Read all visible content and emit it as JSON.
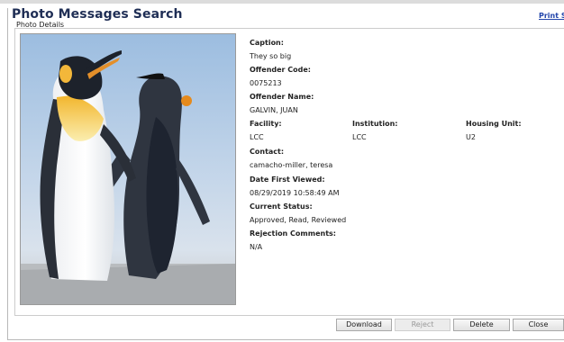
{
  "header": {
    "title": "Photo Messages Search",
    "print_label": "Print Scree"
  },
  "section": {
    "title": "Photo Details"
  },
  "photo": {
    "alt": "Two emperor penguins"
  },
  "fields": {
    "caption_label": "Caption:",
    "caption_value": "They so big",
    "offender_code_label": "Offender Code:",
    "offender_code_value": "0075213",
    "offender_name_label": "Offender Name:",
    "offender_name_value": "GALVIN, JUAN",
    "facility_label": "Facility:",
    "facility_value": "LCC",
    "institution_label": "Institution:",
    "institution_value": "LCC",
    "housing_label": "Housing Unit:",
    "housing_value": "U2",
    "contact_label": "Contact:",
    "contact_value": "camacho-miller, teresa",
    "first_viewed_label": "Date First Viewed:",
    "first_viewed_value": "08/29/2019 10:58:49 AM",
    "status_label": "Current Status:",
    "status_value": "Approved, Read, Reviewed",
    "rejection_label": "Rejection Comments:",
    "rejection_value": "N/A"
  },
  "buttons": {
    "download": "Download",
    "reject": "Reject",
    "delete": "Delete",
    "close": "Close"
  },
  "colors": {
    "title": "#1f2e55",
    "link": "#2244aa"
  }
}
